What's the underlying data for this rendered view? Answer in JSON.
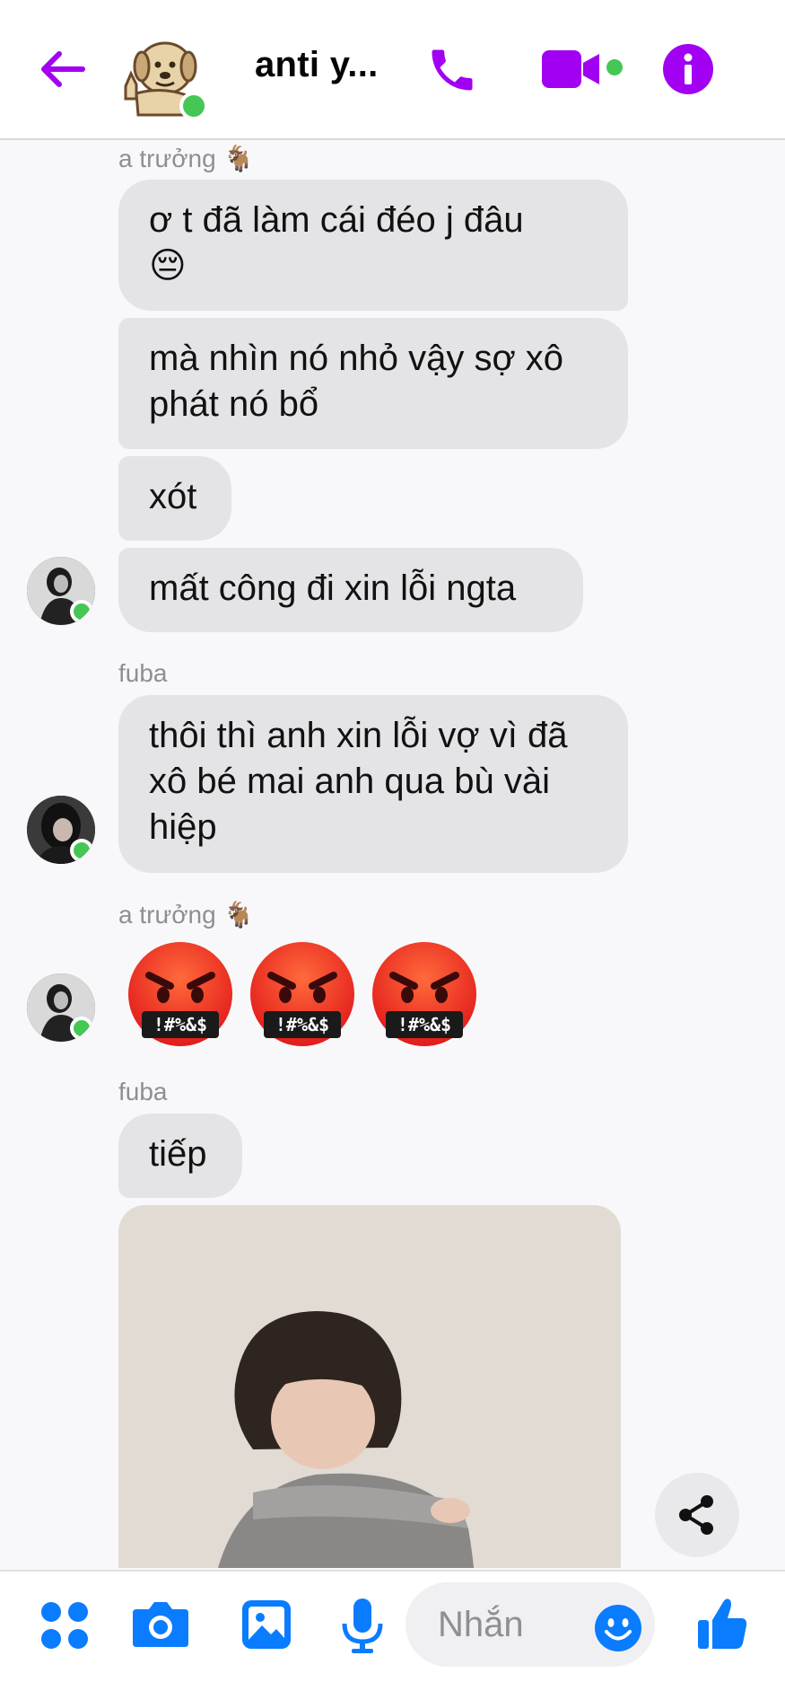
{
  "header": {
    "title": "anti y...",
    "accent": "#a100f2",
    "icons": [
      "back-arrow-icon",
      "phone-icon",
      "video-camera-icon",
      "info-icon"
    ]
  },
  "messages": [
    {
      "sender": "a trưởng 🐐",
      "text": "ơ t đã làm cái đéo j đâu"
    },
    {
      "text": "mà nhìn nó nhỏ vậy sợ xô phát nó bổ"
    },
    {
      "text": "xót"
    },
    {
      "text": "mất công đi xin lỗi ngta"
    },
    {
      "sender": "fuba",
      "text": "thôi thì anh xin lỗi vợ vì đã xô bé mai anh qua bù vài hiệp"
    },
    {
      "sender": "a trưởng 🐐",
      "emojis": [
        "😡",
        "😡",
        "😡"
      ]
    },
    {
      "sender": "fuba",
      "text": "tiếp"
    }
  ],
  "composer": {
    "placeholder": "Nhắn",
    "icons": [
      "menu-dots-icon",
      "camera-icon",
      "gallery-icon",
      "microphone-icon",
      "emoji-icon",
      "thumbs-up-icon"
    ],
    "accent": "#0a7cff"
  },
  "colors": {
    "presence": "#44c755",
    "bubble": "#e4e4e6"
  }
}
